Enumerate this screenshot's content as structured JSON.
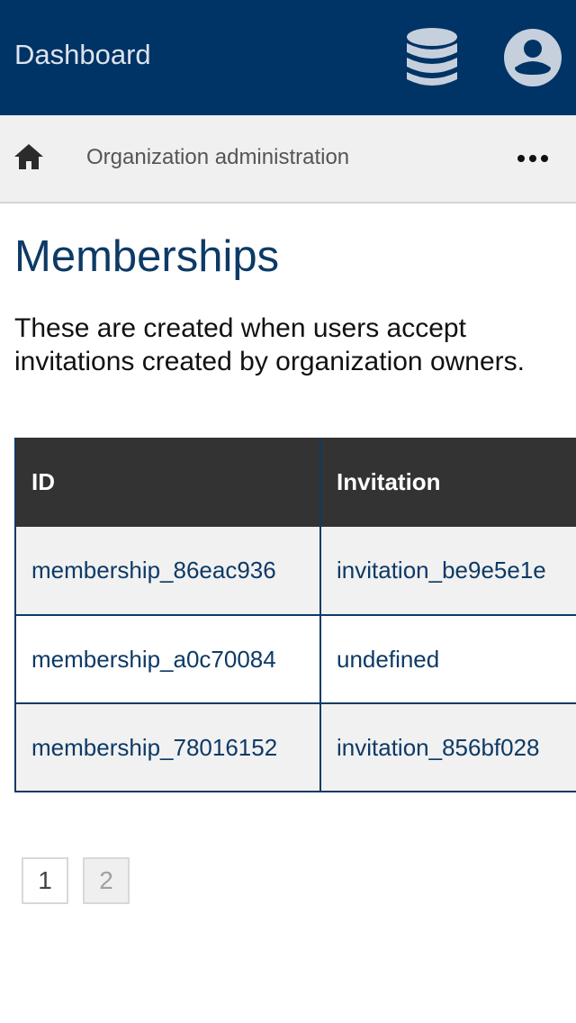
{
  "header": {
    "title": "Dashboard",
    "background": "#003366",
    "icons": {
      "databases": "database-icon",
      "account": "account-circle-icon"
    }
  },
  "breadcrumb": {
    "home_icon": "home-icon",
    "current": "Organization administration",
    "more_icon": "more-horizontal-icon"
  },
  "main": {
    "title": "Memberships",
    "description": "These are created when users accept invitations created by organization owners."
  },
  "table": {
    "columns": [
      "ID",
      "Invitation"
    ],
    "rows": [
      {
        "id": "membership_86eac936",
        "invitation": "invitation_be9e5e1e"
      },
      {
        "id": "membership_a0c70084",
        "invitation": "undefined"
      },
      {
        "id": "membership_78016152",
        "invitation": "invitation_856bf028"
      }
    ]
  },
  "pagination": {
    "pages": [
      "1",
      "2"
    ]
  },
  "colors": {
    "accent": "#0d3a66",
    "table_header": "#333333"
  }
}
